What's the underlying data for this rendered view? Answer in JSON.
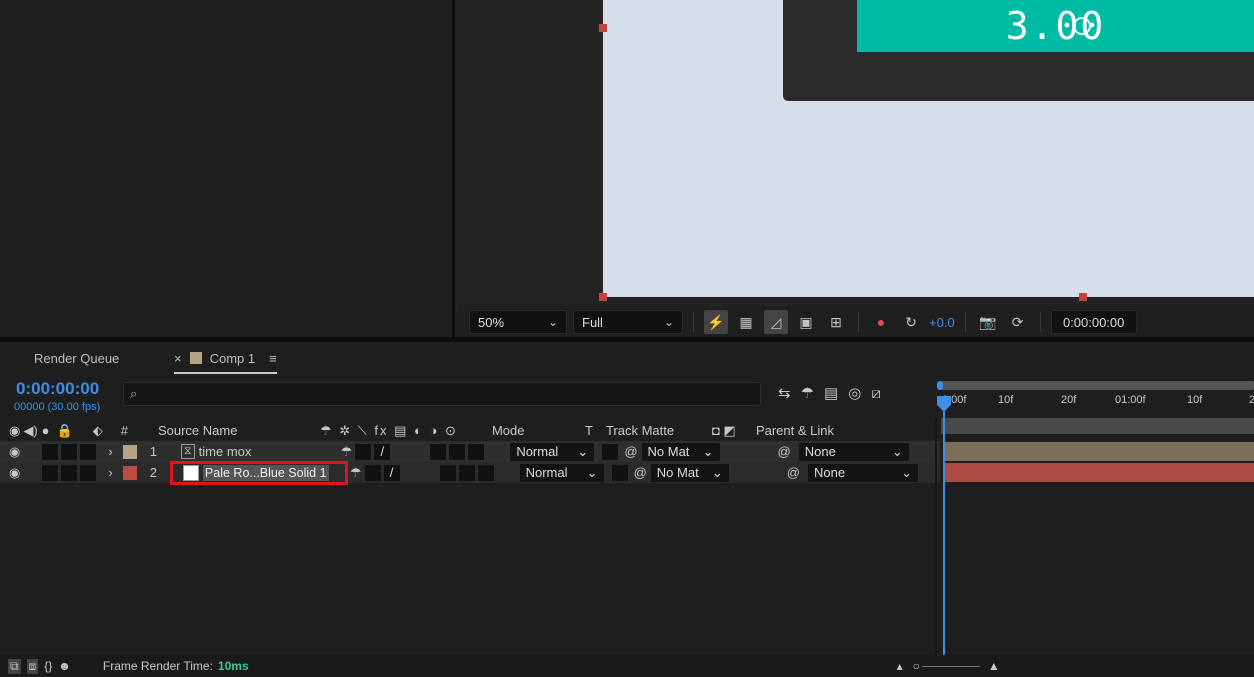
{
  "viewer": {
    "timer_text": "3.00",
    "zoom": "50%",
    "resolution": "Full",
    "exposure": "+0.0",
    "current_time": "0:00:00:00",
    "colors": {
      "timer_bg": "#00bba3",
      "canvas_bg": "#d6dee9",
      "handle": "#c0453a"
    }
  },
  "tabs": {
    "render_queue": "Render Queue",
    "close": "×",
    "comp": "Comp 1",
    "menu": "≡"
  },
  "timeline": {
    "timecode": "0:00:00:00",
    "fps": "00000 (30.00 fps)",
    "columns": {
      "num": "#",
      "source": "Source Name",
      "mode": "Mode",
      "t": "T",
      "track_matte": "Track Matte",
      "parent": "Parent & Link"
    },
    "layers": [
      {
        "num": "1",
        "name": "time mox",
        "mode": "Normal",
        "matte": "No Mat",
        "parent": "None",
        "label_color": "#b5a287",
        "bar_color": "#7c6e5b"
      },
      {
        "num": "2",
        "name": "Pale Ro...Blue Solid 1",
        "mode": "Normal",
        "matte": "No Mat",
        "parent": "None",
        "label_color": "#c04a40",
        "bar_color": "#b04a44"
      }
    ],
    "ruler_ticks": [
      "0:00f",
      "10f",
      "20f",
      "01:00f",
      "10f",
      "2"
    ]
  },
  "status": {
    "label": "Frame Render Time:",
    "value": "10ms"
  }
}
